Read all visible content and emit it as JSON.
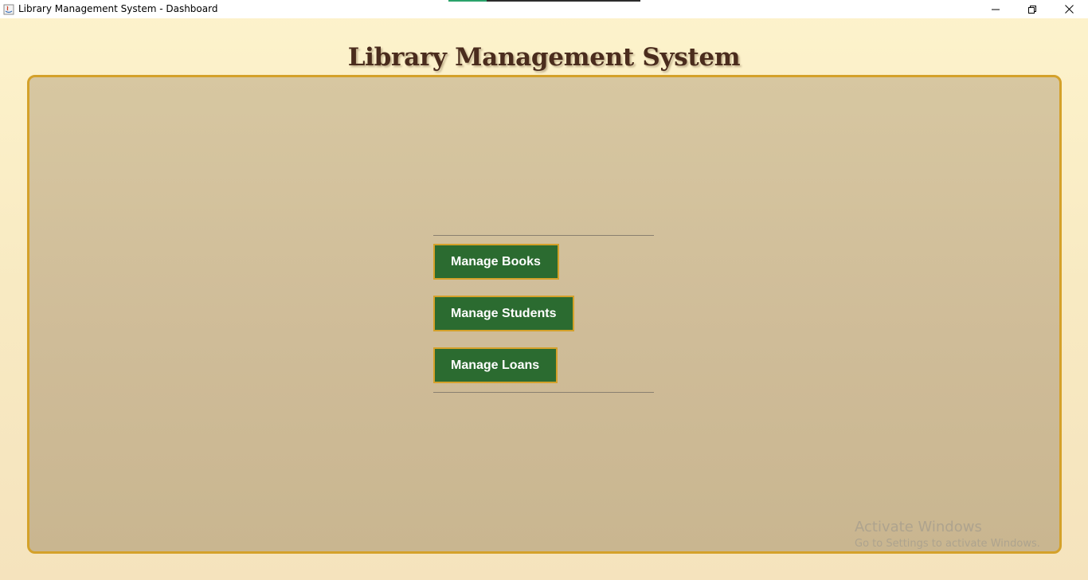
{
  "window": {
    "title": "Library Management System - Dashboard",
    "icon": "java-app-icon",
    "controls": [
      "minimize-icon",
      "restore-icon",
      "close-icon"
    ]
  },
  "header": {
    "title": "Library Management System"
  },
  "menu": {
    "buttons": [
      {
        "label": "Manage Books"
      },
      {
        "label": "Manage Students"
      },
      {
        "label": "Manage Loans"
      }
    ]
  },
  "watermark": {
    "title": "Activate Windows",
    "subtitle": "Go to Settings to activate Windows."
  },
  "colors": {
    "heading": "#4a2c1d",
    "button_bg": "#2b6b30",
    "button_border": "#d4a12a",
    "panel_border": "#d4a12a",
    "panel_bg": "#d3c29c",
    "page_bg": "#fbefc8"
  }
}
